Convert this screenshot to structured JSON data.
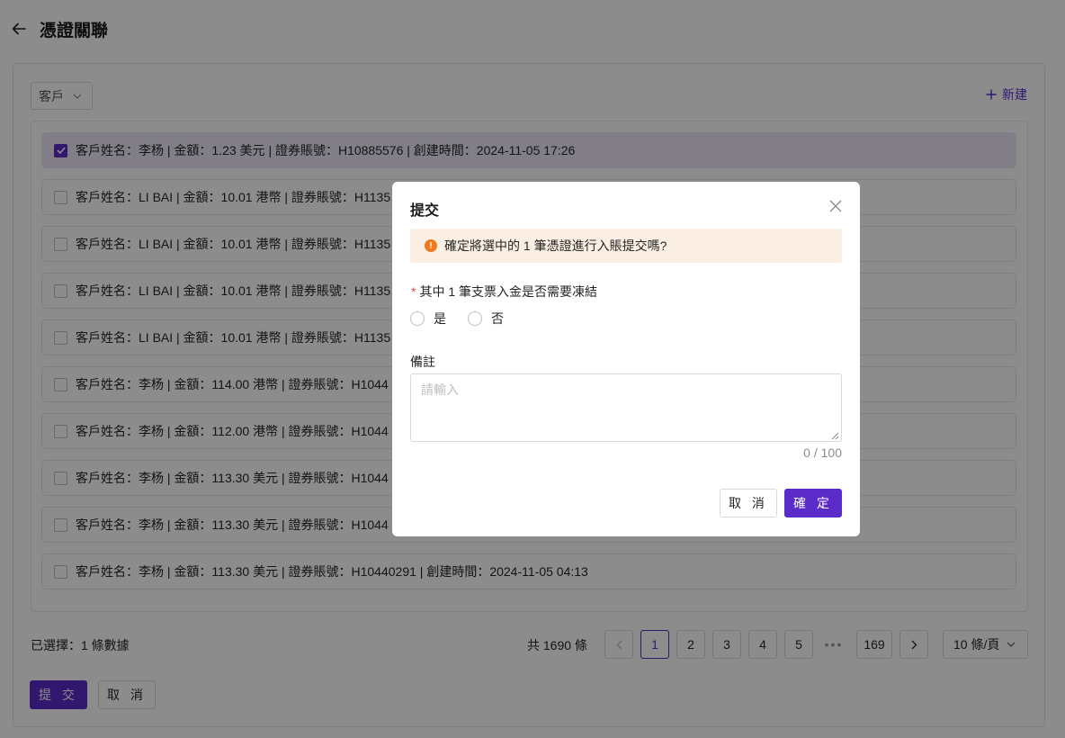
{
  "header": {
    "title": "憑證關聯"
  },
  "filter": {
    "selected": "客戶"
  },
  "toolbar": {
    "new_label": "新建"
  },
  "records": [
    {
      "text": "客戶姓名：李杨 | 金額：1.23 美元 | 證券賬號：H10885576 | 創建時間：2024-11-05 17:26",
      "checked": true
    },
    {
      "text": "客戶姓名：LI BAI | 金額：10.01 港幣 | 證券賬號：H1135",
      "checked": false
    },
    {
      "text": "客戶姓名：LI BAI | 金額：10.01 港幣 | 證券賬號：H1135",
      "checked": false
    },
    {
      "text": "客戶姓名：LI BAI | 金額：10.01 港幣 | 證券賬號：H1135",
      "checked": false
    },
    {
      "text": "客戶姓名：LI BAI | 金額：10.01 港幣 | 證券賬號：H1135",
      "checked": false
    },
    {
      "text": "客戶姓名：李杨 | 金額：114.00 港幣 | 證券賬號：H1044",
      "checked": false
    },
    {
      "text": "客戶姓名：李杨 | 金額：112.00 港幣 | 證券賬號：H1044",
      "checked": false
    },
    {
      "text": "客戶姓名：李杨 | 金額：113.30 美元 | 證券賬號：H1044",
      "checked": false
    },
    {
      "text": "客戶姓名：李杨 | 金額：113.30 美元 | 證券賬號：H1044",
      "checked": false
    },
    {
      "text": "客戶姓名：李杨 | 金額：113.30 美元 | 證券賬號：H10440291 | 創建時間：2024-11-05 04:13",
      "checked": false
    }
  ],
  "footer": {
    "selected_text": "已選擇：1 條數據",
    "total_text": "共 1690 條",
    "pages": [
      "1",
      "2",
      "3",
      "4",
      "5"
    ],
    "current_page": "1",
    "last_page": "169",
    "ellipsis": "•••",
    "page_size": "10 條/頁",
    "submit_label": "提 交",
    "cancel_label": "取 消"
  },
  "modal": {
    "title": "提交",
    "alert_text": "確定將選中的 1 筆憑證進行入賬提交嗎?",
    "alert_icon_glyph": "!",
    "freeze_question": "其中 1 筆支票入金是否需要凍結",
    "required_mark": "*",
    "options": [
      "是",
      "否"
    ],
    "remark_label": "備註",
    "remark_placeholder": "請輸入",
    "remark_value": "",
    "char_count": "0 / 100",
    "cancel_label": "取 消",
    "ok_label": "確 定"
  },
  "colors": {
    "accent": "#5b2bc9",
    "warning": "#ed7a1e",
    "alert_bg": "#fbeee3",
    "selected_row_bg": "#ebe6f7"
  }
}
